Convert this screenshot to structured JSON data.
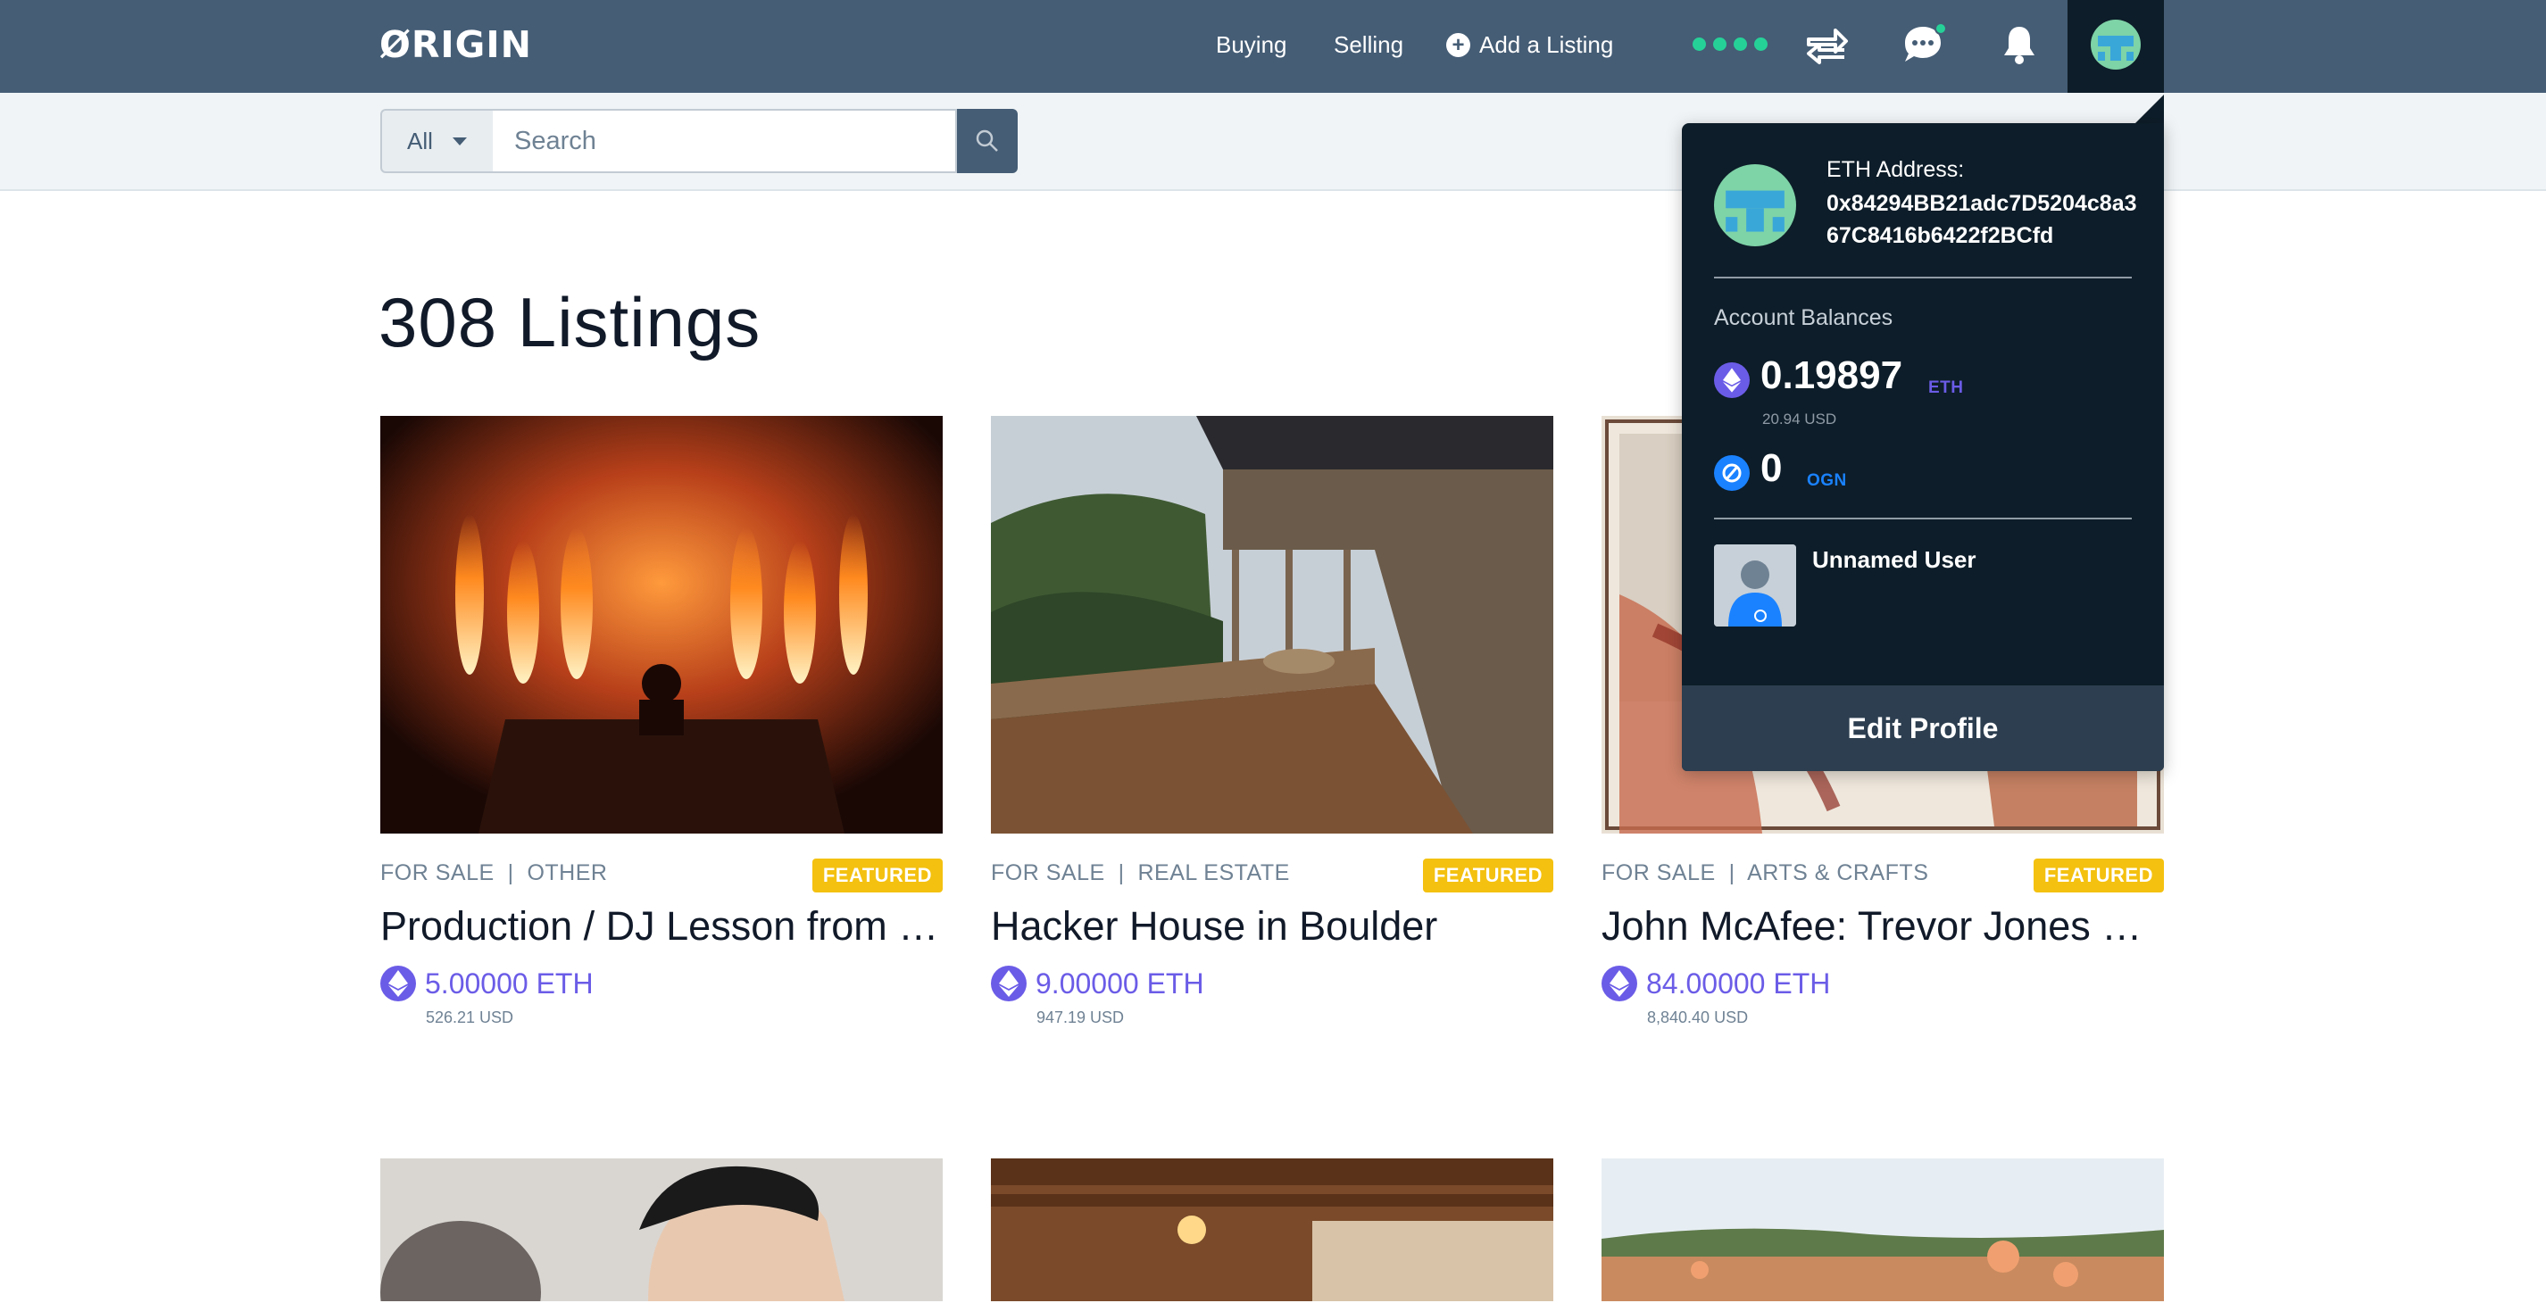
{
  "brand": {
    "logo_text": "ØRIGIN"
  },
  "nav": {
    "buying": "Buying",
    "selling": "Selling",
    "add_listing": "Add a Listing",
    "icons": [
      "connection-status-dots",
      "transfer-icon",
      "chat-icon",
      "bell-icon",
      "identicon-avatar"
    ]
  },
  "search": {
    "category_selected": "All",
    "placeholder": "Search"
  },
  "main": {
    "listings_count_label": "308 Listings",
    "cards": [
      {
        "type": "FOR SALE",
        "separator": "|",
        "category": "OTHER",
        "badge": "FEATURED",
        "title": "Production / DJ Lesson from …",
        "price": "5.00000 ETH",
        "usd": "526.21 USD"
      },
      {
        "type": "FOR SALE",
        "separator": "|",
        "category": "REAL ESTATE",
        "badge": "FEATURED",
        "title": "Hacker House in Boulder",
        "price": "9.00000 ETH",
        "usd": "947.19 USD"
      },
      {
        "type": "FOR SALE",
        "separator": "|",
        "category": "ARTS & CRAFTS",
        "badge": "FEATURED",
        "title": "John McAfee: Trevor Jones O…",
        "price": "84.00000 ETH",
        "usd": "8,840.40 USD"
      }
    ]
  },
  "dropdown": {
    "eth_address_label": "ETH Address:",
    "eth_address": "0x84294BB21adc7D5204c8a367C8416b6422f2BCfd",
    "balances_label": "Account Balances",
    "eth_balance": "0.19897",
    "eth_symbol": "ETH",
    "eth_usd": "20.94 USD",
    "ogn_balance": "0",
    "ogn_symbol": "OGN",
    "user_name": "Unnamed User",
    "edit_profile": "Edit Profile"
  },
  "colors": {
    "navbar": "#455d75",
    "dropdown_bg": "#0d1d29",
    "eth_purple": "#6b5ce7",
    "ogn_blue": "#1a82ff",
    "featured_badge": "#f4c110",
    "status_green": "#26d198"
  }
}
